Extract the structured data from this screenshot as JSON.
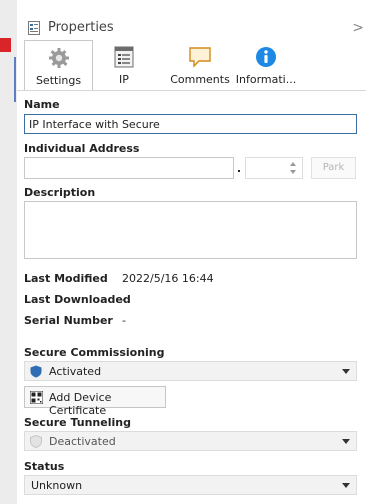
{
  "header": {
    "title": "Properties",
    "chevron": ">"
  },
  "tabs": [
    {
      "label": "Settings"
    },
    {
      "label": "IP"
    },
    {
      "label": "Comments"
    },
    {
      "label": "Informati..."
    }
  ],
  "form": {
    "name_label": "Name",
    "name_value": "IP Interface with Secure",
    "address_label": "Individual Address",
    "address_value": "",
    "address_sub_value": "",
    "park_label": "Park",
    "description_label": "Description",
    "description_value": ""
  },
  "meta": [
    {
      "key": "Last Modified",
      "value": "2022/5/16 16:44"
    },
    {
      "key": "Last Downloaded",
      "value": "-"
    },
    {
      "key": "Serial Number",
      "value": "-"
    }
  ],
  "secure_commissioning": {
    "label": "Secure Commissioning",
    "value": "Activated"
  },
  "add_certificate": {
    "label": "Add Device Certificate"
  },
  "secure_tunneling": {
    "label": "Secure Tunneling",
    "value": "Deactivated"
  },
  "status": {
    "label": "Status",
    "value": "Unknown"
  },
  "colors": {
    "accent_blue": "#3a6ea5",
    "shield_blue": "#2f6db5",
    "info_blue": "#1e88e5",
    "red_bar": "#d9252a"
  }
}
